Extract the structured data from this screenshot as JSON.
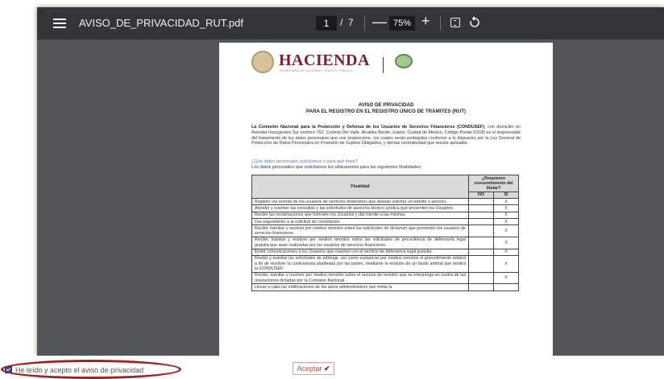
{
  "viewer": {
    "file_name": "AVISO_DE_PRIVACIDAD_RUT.pdf",
    "current_page": "1",
    "page_separator": "/",
    "total_pages": "7",
    "zoom_out": "—",
    "zoom_level": "75%",
    "zoom_in": "+"
  },
  "document": {
    "logo_text": "HACIENDA",
    "logo_subtitle": "SECRETARÍA DE HACIENDA Y CRÉDITO PÚBLICO",
    "title_line1": "AVISO DE PRIVACIDAD",
    "title_line2": "PARA EL REGISTRO EN EL REGISTRO ÚNICO DE TRÁMITES (RUT)",
    "paragraph_bold": "La Comisión Nacional para la Protección y Defensa de los Usuarios de Servicios Financieros (CONDUSEF)",
    "paragraph_rest": ", con domicilio en Avenida Insurgentes Sur número 762, Colonia Del Valle, Alcaldía Benito Juárez, Ciudad de México, Código Postal 03100 es el responsable del tratamiento de los datos personales que nos proporcione, los cuales serán protegidos conforme a lo dispuesto por la Ley General de Protección de Datos Personales en Posesión de Sujetos Obligados, y demás normatividad que resulte aplicable.",
    "question": "¿Qué datos personales solicitamos y para qué fines?",
    "intro": "Los datos personales que solicitamos los utilizaremos para las siguientes finalidades:",
    "table": {
      "col_purpose": "Finalidad",
      "col_consent": "¿Requieren consentimiento del titular?",
      "col_no": "NO",
      "col_si": "SÍ",
      "rows": [
        {
          "text": "Registro vía remota de los usuarios de servicios financieros que desean solicitar un trámite o servicio.",
          "no": "",
          "si": "X"
        },
        {
          "text": "Atender y resolver las consultas y las solicitudes de asesoría técnico jurídica que presenten los Usuarios.",
          "no": "",
          "si": "X"
        },
        {
          "text": "Recibir las reclamaciones que formulen los Usuarios y dar trámite a las mismas.",
          "no": "",
          "si": "X"
        },
        {
          "text": "Dar seguimiento a la solicitud de conciliación.",
          "no": "",
          "si": "X"
        },
        {
          "text": "Recibir, tramitar y resolver por medios remotos sobre las solicitudes de dictamen que presenten los usuarios de servicios financieros.",
          "no": "",
          "si": "X"
        },
        {
          "text": "Recibir, tramitar y resolver por medios remotos sobre las solicitudes de procedencia de defensoría legal gratuita que sean realizadas por los usuarios de servicios financieros.",
          "no": "",
          "si": "X"
        },
        {
          "text": "Emitir comunicaciones a los Usuarios que cuenten con el servicio de defensoría legal gratuita.",
          "no": "",
          "si": "X"
        },
        {
          "text": "Recibir y tramitar las solicitudes de arbitraje, así como sustanciar por medios remotos el procedimiento arbitral a fin de resolver la controversia planteada por las partes, mediante la emisión de un laudo arbitral que emitirá la CONDUSEF.",
          "no": "",
          "si": "X"
        },
        {
          "text": "Recibir, tramitar y resolver por medios remotos sobre el recurso de revisión que se interponga en contra de las resoluciones dictadas por la Comisión Nacional.",
          "no": "",
          "si": "X"
        },
        {
          "text": "Llevar a cabo las notificaciones de los actos administrativos que emita la",
          "no": "",
          "si": ""
        }
      ]
    }
  },
  "footer": {
    "consent_label": "He leído y acepto el aviso de privacidad",
    "accept_label": "Aceptar",
    "accept_check": "✔"
  },
  "colors": {
    "toolbar": "#323639",
    "viewer_bg": "#525659",
    "brand": "#7a1f2b",
    "highlight_oval": "#b11a1a"
  }
}
